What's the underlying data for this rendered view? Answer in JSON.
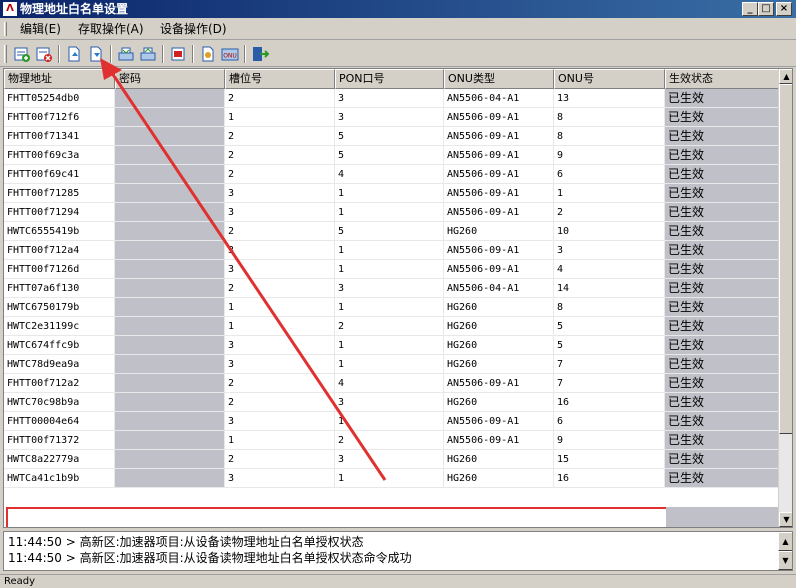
{
  "window": {
    "title": "物理地址白名单设置",
    "app_icon": "app-logo-icon",
    "min_glyph": "_",
    "max_glyph": "□",
    "close_glyph": "×"
  },
  "menu": [
    {
      "label": "编辑(E)"
    },
    {
      "label": "存取操作(A)"
    },
    {
      "label": "设备操作(D)"
    }
  ],
  "toolbar": {
    "buttons": [
      {
        "icon": "add-row-icon"
      },
      {
        "icon": "delete-row-icon"
      },
      {
        "icon": "open-file-icon"
      },
      {
        "icon": "save-file-icon"
      },
      {
        "icon": "read-device-icon"
      },
      {
        "icon": "write-device-icon"
      },
      {
        "icon": "import-icon"
      },
      {
        "icon": "export-icon"
      },
      {
        "icon": "onu-icon",
        "text": "ONU"
      },
      {
        "icon": "exit-icon"
      }
    ]
  },
  "grid": {
    "columns": [
      "物理地址",
      "密码",
      "槽位号",
      "PON口号",
      "ONU类型",
      "ONU号",
      "生效状态"
    ],
    "rows": [
      [
        "FHTT05254db0",
        "",
        "2",
        "3",
        "AN5506-04-A1",
        "13",
        "已生效"
      ],
      [
        "FHTT00f712f6",
        "",
        "1",
        "3",
        "AN5506-09-A1",
        "8",
        "已生效"
      ],
      [
        "FHTT00f71341",
        "",
        "2",
        "5",
        "AN5506-09-A1",
        "8",
        "已生效"
      ],
      [
        "FHTT00f69c3a",
        "",
        "2",
        "5",
        "AN5506-09-A1",
        "9",
        "已生效"
      ],
      [
        "FHTT00f69c41",
        "",
        "2",
        "4",
        "AN5506-09-A1",
        "6",
        "已生效"
      ],
      [
        "FHTT00f71285",
        "",
        "3",
        "1",
        "AN5506-09-A1",
        "1",
        "已生效"
      ],
      [
        "FHTT00f71294",
        "",
        "3",
        "1",
        "AN5506-09-A1",
        "2",
        "已生效"
      ],
      [
        "HWTC6555419b",
        "",
        "2",
        "5",
        "HG260",
        "10",
        "已生效"
      ],
      [
        "FHTT00f712a4",
        "",
        "3",
        "1",
        "AN5506-09-A1",
        "3",
        "已生效"
      ],
      [
        "FHTT00f7126d",
        "",
        "3",
        "1",
        "AN5506-09-A1",
        "4",
        "已生效"
      ],
      [
        "FHTT07a6f130",
        "",
        "2",
        "3",
        "AN5506-04-A1",
        "14",
        "已生效"
      ],
      [
        "HWTC6750179b",
        "",
        "1",
        "1",
        "HG260",
        "8",
        "已生效"
      ],
      [
        "HWTC2e31199c",
        "",
        "1",
        "2",
        "HG260",
        "5",
        "已生效"
      ],
      [
        "HWTC674ffc9b",
        "",
        "3",
        "1",
        "HG260",
        "5",
        "已生效"
      ],
      [
        "HWTC78d9ea9a",
        "",
        "3",
        "1",
        "HG260",
        "7",
        "已生效"
      ],
      [
        "FHTT00f712a2",
        "",
        "2",
        "4",
        "AN5506-09-A1",
        "7",
        "已生效"
      ],
      [
        "HWTC70c98b9a",
        "",
        "2",
        "3",
        "HG260",
        "16",
        "已生效"
      ],
      [
        "FHTT00004e64",
        "",
        "3",
        "1",
        "AN5506-09-A1",
        "6",
        "已生效"
      ],
      [
        "FHTT00f71372",
        "",
        "1",
        "2",
        "AN5506-09-A1",
        "9",
        "已生效"
      ],
      [
        "HWTC8a22779a",
        "",
        "2",
        "3",
        "HG260",
        "15",
        "已生效"
      ],
      [
        "HWTCa41c1b9b",
        "",
        "3",
        "1",
        "HG260",
        "16",
        "已生效"
      ]
    ]
  },
  "log": [
    "11:44:50 > 高新区:加速器项目:从设备读物理地址白名单授权状态",
    "11:44:50 > 高新区:加速器项目:从设备读物理地址白名单授权状态命令成功"
  ],
  "status": "Ready",
  "colors": {
    "title_bar_start": "#0a246a",
    "title_bar_end": "#3a6ea5",
    "annotation": "#e03030",
    "grid_gray": "#c0c0c8"
  },
  "scroll": {
    "up_glyph": "▲",
    "down_glyph": "▼"
  }
}
